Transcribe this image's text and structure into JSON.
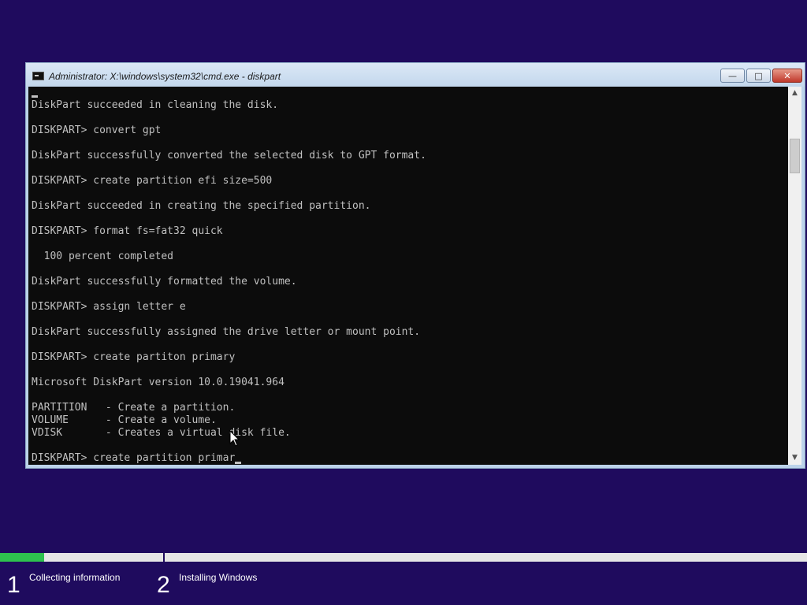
{
  "window": {
    "title": "Administrator: X:\\windows\\system32\\cmd.exe - diskpart",
    "buttons": {
      "minimize": "—",
      "maximize": "□",
      "close": "✕"
    }
  },
  "console": {
    "lines": [
      "DiskPart succeeded in cleaning the disk.",
      "",
      "DISKPART> convert gpt",
      "",
      "DiskPart successfully converted the selected disk to GPT format.",
      "",
      "DISKPART> create partition efi size=500",
      "",
      "DiskPart succeeded in creating the specified partition.",
      "",
      "DISKPART> format fs=fat32 quick",
      "",
      "  100 percent completed",
      "",
      "DiskPart successfully formatted the volume.",
      "",
      "DISKPART> assign letter e",
      "",
      "DiskPart successfully assigned the drive letter or mount point.",
      "",
      "DISKPART> create partiton primary",
      "",
      "Microsoft DiskPart version 10.0.19041.964",
      "",
      "PARTITION   - Create a partition.",
      "VOLUME      - Create a volume.",
      "VDISK       - Creates a virtual disk file.",
      ""
    ],
    "input_line": "DISKPART> create partition primar"
  },
  "setup": {
    "progress": 0.055,
    "steps": [
      {
        "number": "1",
        "label": "Collecting information"
      },
      {
        "number": "2",
        "label": "Installing Windows"
      }
    ]
  },
  "colors": {
    "background": "#1f0b5e",
    "console_bg": "#0c0c0c",
    "console_text": "#c0c0c0",
    "progress_fill": "#2ec24e"
  },
  "icons": [
    "cmd-app-icon",
    "minimize-icon",
    "maximize-icon",
    "close-icon",
    "scroll-up-icon",
    "scroll-down-icon",
    "mouse-pointer-icon"
  ]
}
